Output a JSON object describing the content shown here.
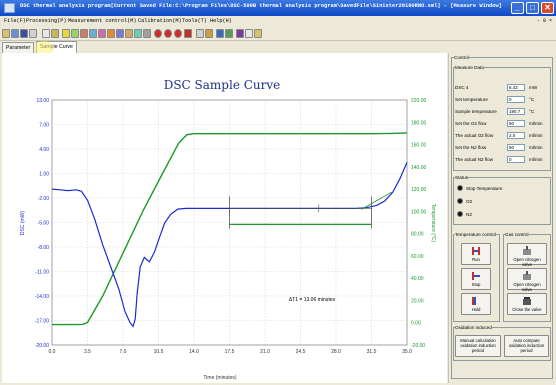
{
  "window": {
    "title": "DSC thermal analysis program[Current Saved File:C:\\Program Files\\DSC-500B thermal analysis program\\SavedFile\\Sinister20160RNO.sml] - [Measure Window]",
    "buttons": [
      "_",
      "□",
      "✕"
    ]
  },
  "menu": {
    "items": [
      "File(F)",
      "Processing(P)",
      "Measurement control(M)",
      "Calibration(M)",
      "Tools(T)",
      "Help(H)"
    ],
    "tail": "- 8 ×"
  },
  "tabs": [
    "Parameter",
    "Sample Curve"
  ],
  "chart_data": {
    "type": "line",
    "title": "DSC Sample Curve",
    "xlabel": "Time (minutes)",
    "ylabel": "DSC (mW)",
    "ylabel_right": "Temperature (°C)",
    "xlim": [
      0.0,
      35.0
    ],
    "ylim": [
      -20.0,
      13.0
    ],
    "ylim_right": [
      -20.0,
      220.0
    ],
    "x_ticks": [
      "0.0",
      "3.5",
      "7.0",
      "10.5",
      "14.0",
      "17.5",
      "21.0",
      "24.5",
      "28.0",
      "31.5",
      "35.0"
    ],
    "y_ticks": [
      "13.00",
      "7.00",
      "4.00",
      "1.00",
      "-2.00",
      "-5.00",
      "-8.00",
      "-11.00",
      "-14.00",
      "-17.00",
      "-20.00"
    ],
    "y_ticks_right": [
      "220.00",
      "180.00",
      "160.00",
      "140.00",
      "120.00",
      "100.00",
      "80.00",
      "60.00",
      "40.00",
      "20.00",
      "0.00",
      "-20.00"
    ],
    "annotation": "ΔT1 = 13.06 minutes",
    "grid": true,
    "series": [
      {
        "color": "#1a2bd0",
        "x": [
          0,
          0.8,
          1.6,
          2.4,
          2.9,
          3.5,
          4.2,
          5.0,
          5.8,
          6.6,
          7.2,
          7.7,
          8.0,
          8.2,
          8.4,
          8.7,
          9.1,
          9.6,
          10.1,
          10.6,
          11.1,
          11.7,
          12.4,
          13.2,
          14.0,
          15.0,
          17.5,
          21.0,
          24.5,
          28.0,
          30.0,
          31.0,
          32.0,
          32.8,
          33.6,
          34.3,
          35.0
        ],
        "y": [
          1.0,
          0.9,
          0.8,
          0.9,
          0.7,
          -0.5,
          -3.0,
          -6.5,
          -9.5,
          -12.5,
          -15.5,
          -17.0,
          -17.5,
          -16.5,
          -13.0,
          -9.5,
          -8.2,
          -8.8,
          -7.5,
          -5.5,
          -3.6,
          -2.4,
          -1.7,
          -1.6,
          -1.6,
          -1.6,
          -1.6,
          -1.6,
          -1.6,
          -1.6,
          -1.6,
          -1.5,
          -1.2,
          -0.6,
          0.6,
          2.4,
          4.6
        ]
      },
      {
        "color": "#1c9a2c",
        "x": [
          0,
          1.0,
          2.0,
          3.0,
          3.5,
          5.0,
          7.0,
          9.0,
          11.0,
          12.5,
          13.3,
          14.0,
          17.5,
          21.0,
          24.5,
          28.0,
          31.5,
          33.5,
          35.0
        ],
        "y": [
          0.0,
          0.0,
          0.0,
          0.2,
          2.0,
          28.0,
          70.0,
          112.0,
          150.0,
          178.0,
          186.0,
          187.0,
          187.0,
          187.0,
          187.0,
          187.0,
          187.0,
          187.3,
          187.8
        ]
      }
    ],
    "markers": {
      "cursor_x": [
        17.5,
        31.5
      ]
    }
  },
  "control": {
    "group_title": "Control",
    "measure_title": "Measure Data",
    "rows": [
      {
        "label": "DSC 4",
        "value": "6.42",
        "unit": "mW"
      },
      {
        "label": "Set temperature",
        "value": "0",
        "unit": "°C"
      },
      {
        "label": "Sample temperature",
        "value": "190.7",
        "unit": "°C"
      },
      {
        "label": "Set the O2 flow",
        "value": "50",
        "unit": "ml/min"
      },
      {
        "label": "The actual O2 flow",
        "value": "2.0",
        "unit": "ml/min"
      },
      {
        "label": "Set the N2 flow",
        "value": "50",
        "unit": "ml/min"
      },
      {
        "label": "The actual N2 flow",
        "value": "0",
        "unit": "ml/min"
      }
    ],
    "status_title": "Status",
    "status": [
      "Stop Temperature",
      "O2",
      "N2"
    ],
    "temp_control_title": "Temperature control",
    "gas_control_title": "Gas control",
    "temp_buttons": [
      "Run",
      "Stop",
      "Hold"
    ],
    "gas_buttons": [
      "Open nitrogen valve",
      "Open nitrogen valve",
      "Close the valve"
    ],
    "oxidation_title": "Oxidation induced",
    "oxidation_buttons": [
      "Manual calculation oxidation induction period",
      "Auto compute oxidation induction period"
    ]
  }
}
